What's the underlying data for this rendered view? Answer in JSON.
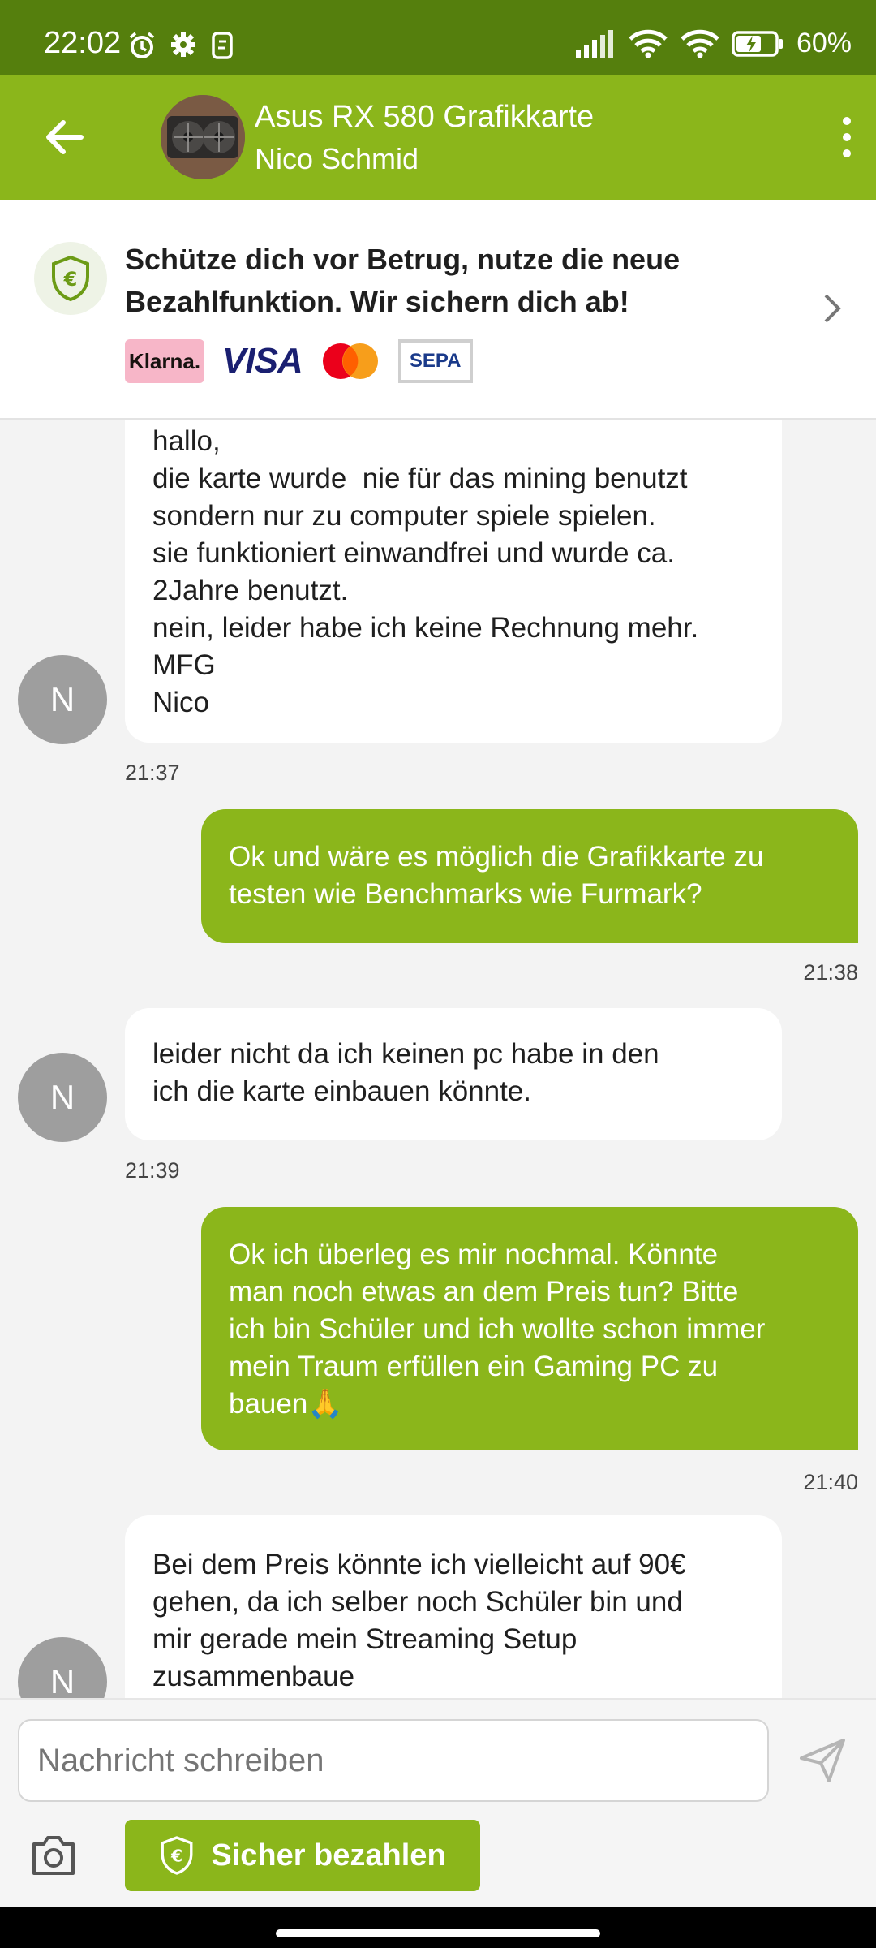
{
  "status_bar": {
    "time": "22:02",
    "battery": "60%",
    "icons": [
      "alarm-icon",
      "settings-icon",
      "nfc-icon",
      "signal-icon",
      "wifi-icon",
      "wifi-icon",
      "battery-icon"
    ]
  },
  "header": {
    "title": "Asus RX 580 Grafikkarte",
    "subtitle": "Nico Schmid"
  },
  "banner": {
    "text": "Schütze dich vor Betrug, nutze die neue Bezahlfunktion. Wir sichern dich ab!",
    "payment_logos": {
      "klarna": "Klarna.",
      "visa": "VISA",
      "sepa": "SEPA"
    }
  },
  "messages": [
    {
      "sender": "other",
      "avatar": "N",
      "lines": [
        "hallo,",
        "die karte wurde  nie für das mining benutzt",
        "sondern nur zu computer spiele spielen.",
        "sie funktioniert einwandfrei und wurde ca.",
        "2Jahre benutzt.",
        "nein, leider habe ich keine Rechnung mehr.",
        "MFG",
        "Nico"
      ],
      "time": "21:37"
    },
    {
      "sender": "me",
      "lines": [
        "Ok und wäre es möglich die Grafikkarte zu",
        "testen wie Benchmarks wie Furmark?"
      ],
      "time": "21:38"
    },
    {
      "sender": "other",
      "avatar": "N",
      "lines": [
        "leider nicht da ich keinen pc habe in den",
        "ich die karte einbauen könnte."
      ],
      "time": "21:39"
    },
    {
      "sender": "me",
      "lines": [
        "Ok ich überleg es mir nochmal. Könnte",
        "man noch etwas an dem Preis tun? Bitte",
        "ich bin Schüler und ich wollte schon immer",
        "mein Traum erfüllen ein Gaming PC zu",
        "bauen🙏"
      ],
      "time": "21:40"
    },
    {
      "sender": "other",
      "avatar": "N",
      "lines": [
        "Bei dem Preis könnte ich vielleicht auf 90€",
        "gehen, da ich selber noch Schüler bin und",
        "mir gerade mein Streaming Setup",
        "zusammenbaue"
      ],
      "time": ""
    }
  ],
  "composer": {
    "placeholder": "Nachricht schreiben",
    "secure_pay_label": "Sicher bezahlen"
  },
  "colors": {
    "status_bar": "#557f0d",
    "brand_green": "#8bb61b",
    "chat_bg": "#f3f3f3"
  }
}
